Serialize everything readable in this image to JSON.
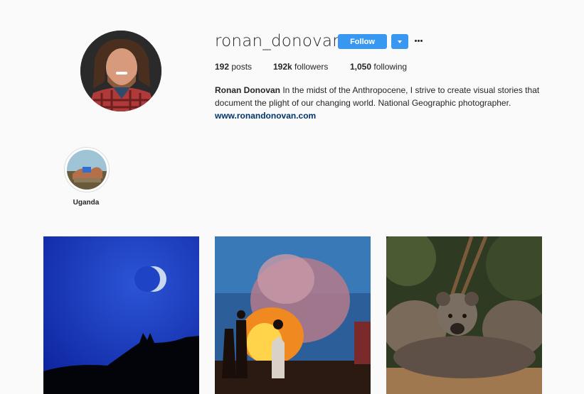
{
  "profile": {
    "username": "ronan_donovan",
    "follow_label": "Follow",
    "stats": {
      "posts_count": "192",
      "posts_label": "posts",
      "followers_count": "192k",
      "followers_label": "followers",
      "following_count": "1,050",
      "following_label": "following"
    },
    "full_name": "Ronan Donovan",
    "bio_line1": "In the midst of the Anthropocene, I strive to create visual stories that",
    "bio_line2": "document the plight of our changing world. National Geographic photographer.",
    "website": "www.ronandonovan.com"
  },
  "highlights": [
    {
      "label": "Uganda"
    }
  ],
  "icons": {
    "dropdown": "chevron-down-icon",
    "more": "more-options-icon"
  },
  "colors": {
    "accent": "#3897f0",
    "background": "#fafafa",
    "link": "#003569"
  }
}
